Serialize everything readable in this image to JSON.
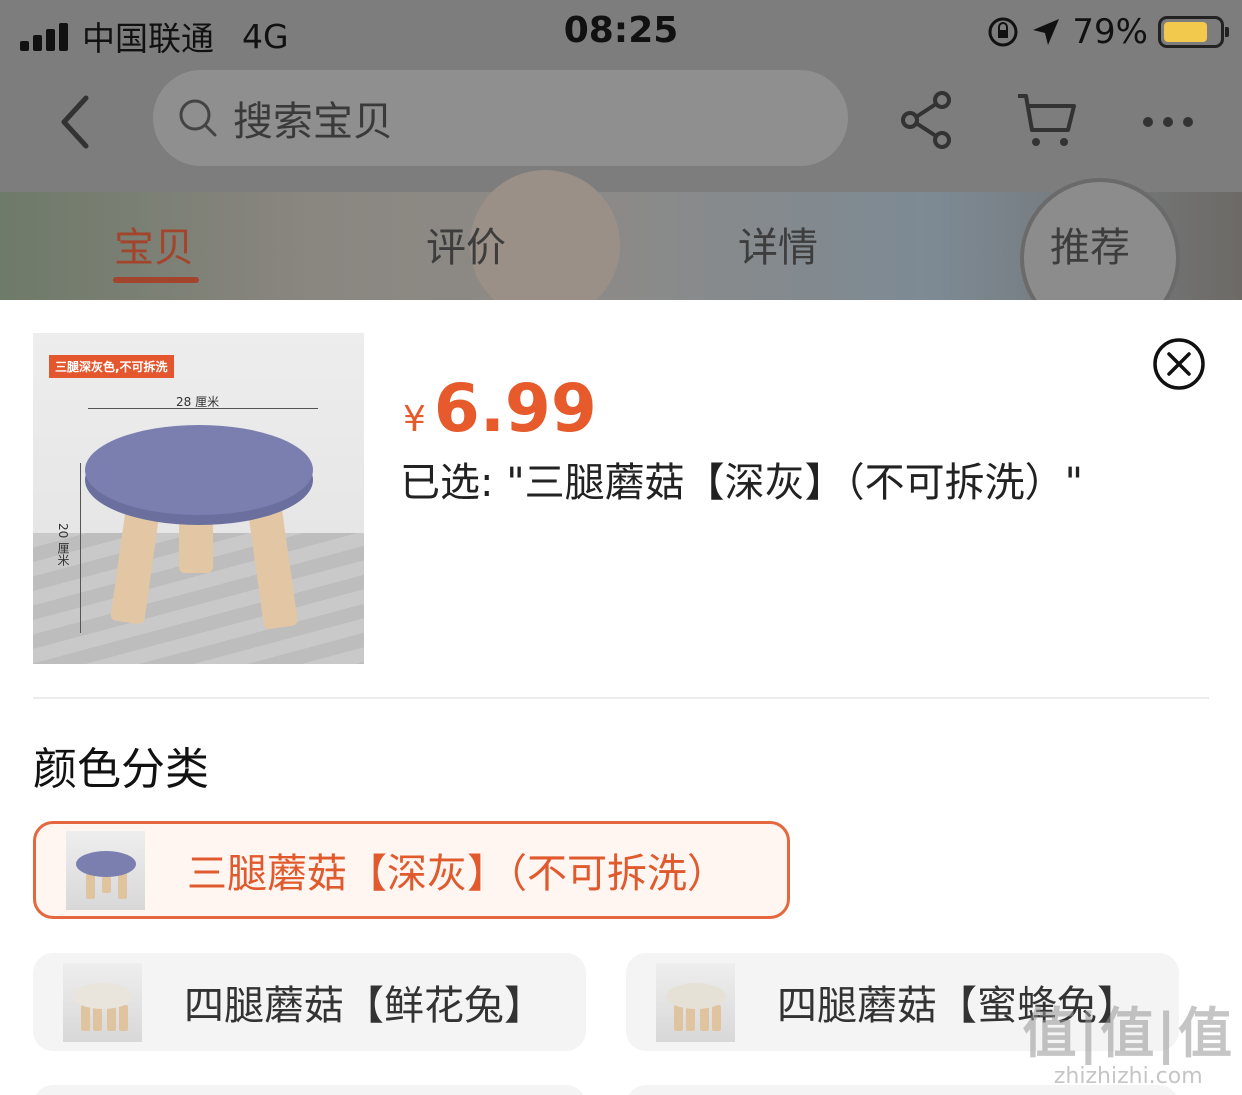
{
  "status_bar": {
    "carrier": "中国联通",
    "network": "4G",
    "time": "08:25",
    "battery_percent": "79%",
    "battery_level": 0.79
  },
  "navbar": {
    "search_placeholder": "搜索宝贝",
    "icons": [
      "back-icon",
      "search-icon",
      "share-icon",
      "cart-icon",
      "more-icon"
    ]
  },
  "tabs": [
    {
      "label": "宝贝",
      "active": true
    },
    {
      "label": "评价",
      "active": false
    },
    {
      "label": "详情",
      "active": false
    },
    {
      "label": "推荐",
      "active": false
    }
  ],
  "product": {
    "image_tag": "三腿深灰色,不可拆洗",
    "width_label": "28 厘米",
    "height_label": "20 厘米",
    "currency": "¥",
    "price": "6.99",
    "selected_text": "已选: \"三腿蘑菇【深灰】（不可拆洗）\""
  },
  "section": {
    "title": "颜色分类"
  },
  "options": [
    {
      "label": "三腿蘑菇【深灰】（不可拆洗）",
      "selected": true,
      "seat_color": "#7a7fb0"
    },
    {
      "label": "四腿蘑菇【鲜花兔】",
      "selected": false,
      "seat_color": "#e9e4dc"
    },
    {
      "label": "四腿蘑菇【蜜蜂兔】",
      "selected": false,
      "seat_color": "#e6e1d6"
    }
  ],
  "watermark": {
    "text": "值|值|值",
    "site": "zhizhizhi.com"
  },
  "colors": {
    "accent": "#e4673d",
    "price": "#e65a2c",
    "overlay": "#7d7d7d"
  }
}
